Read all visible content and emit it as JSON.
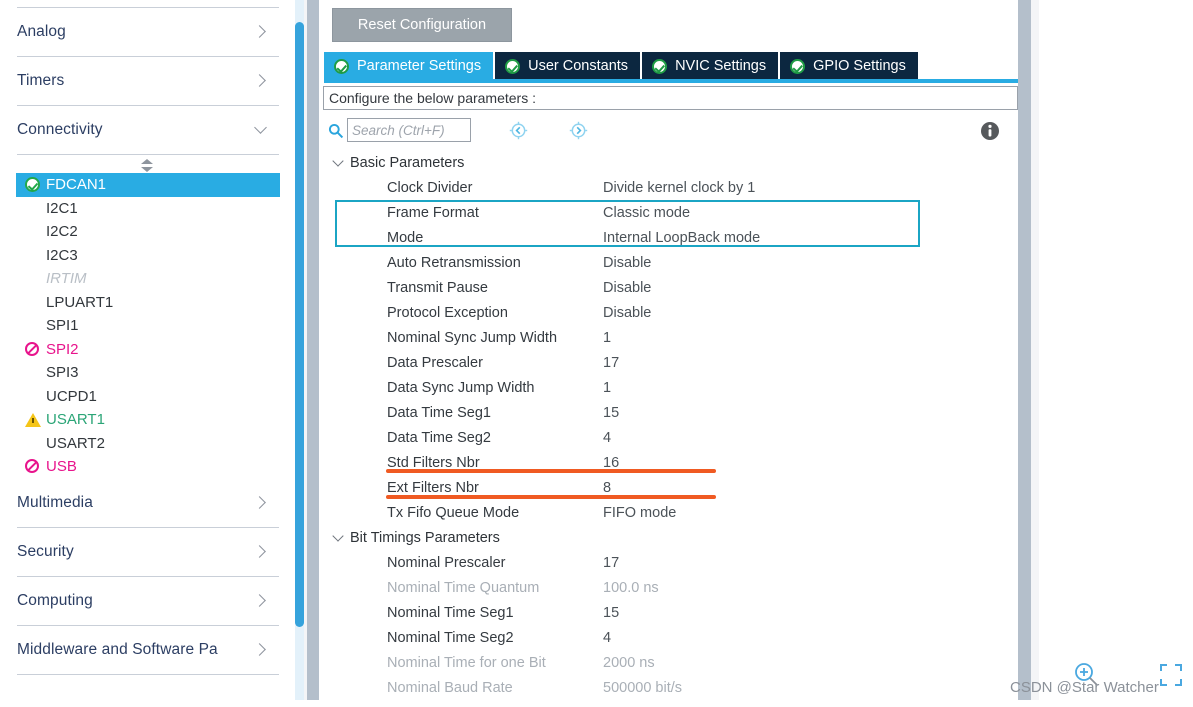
{
  "sidebar": {
    "categories_top": [
      {
        "label": "Analog",
        "expanded": false,
        "icon": "chevron-right-icon"
      },
      {
        "label": "Timers",
        "expanded": false,
        "icon": "chevron-right-icon"
      },
      {
        "label": "Connectivity",
        "expanded": true,
        "icon": "chevron-down-icon"
      }
    ],
    "peripherals": [
      {
        "label": "FDCAN1",
        "state": "selected",
        "icon": "check-circle-icon"
      },
      {
        "label": "I2C1",
        "state": "normal",
        "icon": "none"
      },
      {
        "label": "I2C2",
        "state": "normal",
        "icon": "none"
      },
      {
        "label": "I2C3",
        "state": "normal",
        "icon": "none"
      },
      {
        "label": "IRTIM",
        "state": "disabled",
        "icon": "none"
      },
      {
        "label": "LPUART1",
        "state": "normal",
        "icon": "none"
      },
      {
        "label": "SPI1",
        "state": "normal",
        "icon": "none"
      },
      {
        "label": "SPI2",
        "state": "conflict",
        "icon": "no-entry-icon"
      },
      {
        "label": "SPI3",
        "state": "normal",
        "icon": "none"
      },
      {
        "label": "UCPD1",
        "state": "normal",
        "icon": "none"
      },
      {
        "label": "USART1",
        "state": "warn",
        "icon": "warning-triangle-icon"
      },
      {
        "label": "USART2",
        "state": "normal",
        "icon": "none"
      },
      {
        "label": "USB",
        "state": "conflict",
        "icon": "no-entry-icon"
      }
    ],
    "categories_bottom": [
      {
        "label": "Multimedia",
        "expanded": false,
        "icon": "chevron-right-icon"
      },
      {
        "label": "Security",
        "expanded": false,
        "icon": "chevron-right-icon"
      },
      {
        "label": "Computing",
        "expanded": false,
        "icon": "chevron-right-icon"
      },
      {
        "label": "Middleware and Software Pa",
        "expanded": false,
        "icon": "chevron-right-icon"
      }
    ]
  },
  "main": {
    "reset_button": "Reset Configuration",
    "tabs": [
      {
        "label": "Parameter Settings",
        "active": true,
        "icon": "check-circle-icon"
      },
      {
        "label": "User Constants",
        "active": false,
        "icon": "check-circle-icon"
      },
      {
        "label": "NVIC Settings",
        "active": false,
        "icon": "check-circle-icon"
      },
      {
        "label": "GPIO Settings",
        "active": false,
        "icon": "check-circle-icon"
      }
    ],
    "configure_bar": "Configure the below parameters :",
    "search": {
      "placeholder": "Search (Ctrl+F)",
      "value": "",
      "icon": "search-icon",
      "prev_icon": "nav-previous-icon",
      "next_icon": "nav-next-icon",
      "info_icon": "info-icon"
    },
    "groups": [
      {
        "title": "Basic Parameters",
        "expanded": true,
        "rows": [
          {
            "label": "Clock Divider",
            "value": "Divide kernel clock by 1",
            "dim": false
          },
          {
            "label": "Frame Format",
            "value": "Classic mode",
            "dim": false
          },
          {
            "label": "Mode",
            "value": "Internal LoopBack mode",
            "dim": false
          },
          {
            "label": "Auto Retransmission",
            "value": "Disable",
            "dim": false
          },
          {
            "label": "Transmit Pause",
            "value": "Disable",
            "dim": false
          },
          {
            "label": "Protocol Exception",
            "value": "Disable",
            "dim": false
          },
          {
            "label": "Nominal Sync Jump Width",
            "value": "1",
            "dim": false
          },
          {
            "label": "Data Prescaler",
            "value": "17",
            "dim": false
          },
          {
            "label": "Data Sync Jump Width",
            "value": "1",
            "dim": false
          },
          {
            "label": "Data Time Seg1",
            "value": "15",
            "dim": false
          },
          {
            "label": "Data Time Seg2",
            "value": "4",
            "dim": false
          },
          {
            "label": "Std Filters Nbr",
            "value": "16",
            "dim": false
          },
          {
            "label": "Ext Filters Nbr",
            "value": "8",
            "dim": false
          },
          {
            "label": "Tx Fifo Queue Mode",
            "value": "FIFO mode",
            "dim": false
          }
        ]
      },
      {
        "title": "Bit Timings Parameters",
        "expanded": true,
        "rows": [
          {
            "label": "Nominal Prescaler",
            "value": "17",
            "dim": false
          },
          {
            "label": "Nominal Time Quantum",
            "value": "100.0 ns",
            "dim": true
          },
          {
            "label": "Nominal Time Seg1",
            "value": "15",
            "dim": false
          },
          {
            "label": "Nominal Time Seg2",
            "value": "4",
            "dim": false
          },
          {
            "label": "Nominal Time for one Bit",
            "value": "2000 ns",
            "dim": true
          },
          {
            "label": "Nominal Baud Rate",
            "value": "500000 bit/s",
            "dim": true
          }
        ]
      }
    ]
  },
  "annotations": {
    "teal_box_rows": [
      "Frame Format",
      "Mode"
    ],
    "orange_underline_rows": [
      "Std Filters Nbr",
      "Ext Filters Nbr"
    ],
    "teal_color": "#1ba5c4",
    "orange_color": "#f05a22"
  },
  "watermark": {
    "text": "CSDN @Star Watcher",
    "zoom_icon": "zoom-in-icon",
    "crop_icon": "crop-corner-icon"
  },
  "colors": {
    "accent_cyan": "#29ace3",
    "tab_inactive": "#0c2740",
    "selected_row": "#29ace3",
    "conflict_pink": "#e8148c",
    "ok_green": "#21a84a",
    "warn_yellow": "#f5c518",
    "splitter_gray": "#b4bfcb"
  }
}
